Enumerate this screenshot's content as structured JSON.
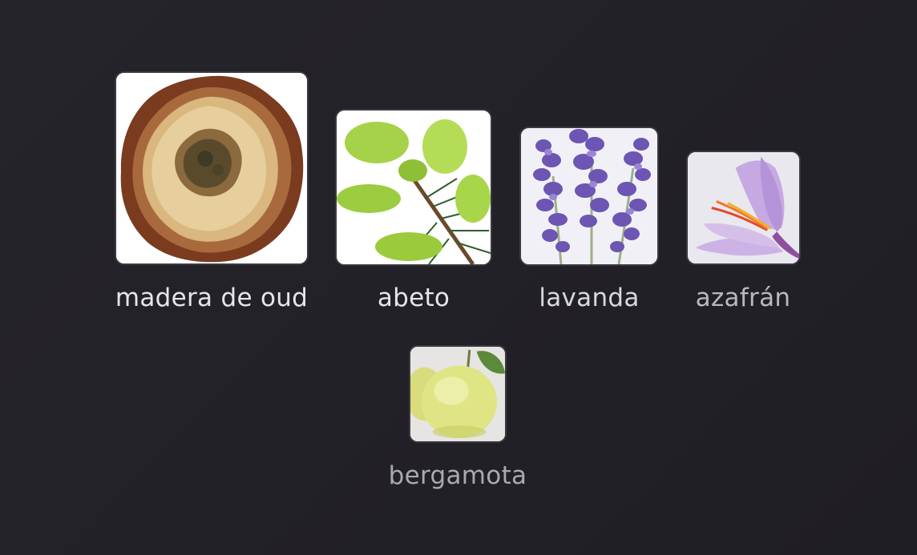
{
  "notes": [
    {
      "name": "madera de oud",
      "label": "madera de oud",
      "icon": "oud-wood-image",
      "text_color": "#e6e6ea"
    },
    {
      "name": "abeto",
      "label": "abeto",
      "icon": "fir-branch-image",
      "text_color": "#e6e6ea"
    },
    {
      "name": "lavanda",
      "label": "lavanda",
      "icon": "lavender-image",
      "text_color": "#d8d8dd"
    },
    {
      "name": "azafrán",
      "label": "azafrán",
      "icon": "saffron-flower-image",
      "text_color": "#b8b8be"
    },
    {
      "name": "bergamota",
      "label": "bergamota",
      "icon": "bergamot-fruit-image",
      "text_color": "#a9a9b0"
    }
  ],
  "colors": {
    "background": "#232228",
    "tile_border": "#3a3940"
  }
}
